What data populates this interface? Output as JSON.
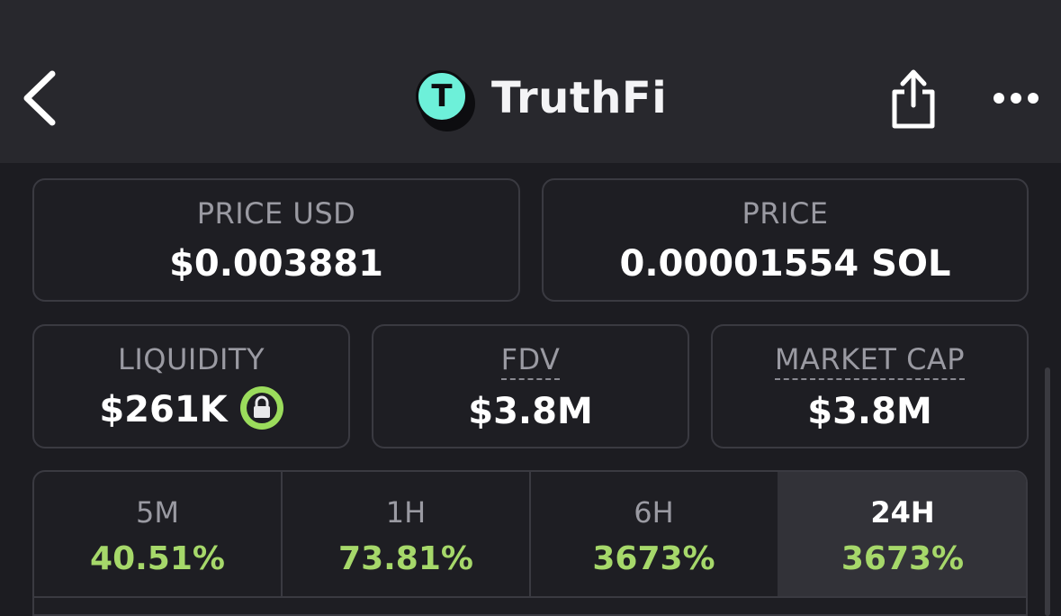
{
  "header": {
    "title": "TruthFi",
    "logo_letter": "T",
    "logo_color": "#6df0d9"
  },
  "icons": {
    "back": "chevron-left-icon",
    "share": "share-icon",
    "more": "more-horizontal-icon",
    "lock": "lock-icon"
  },
  "price_cards": [
    {
      "label": "PRICE USD",
      "value": "$0.003881"
    },
    {
      "label": "PRICE",
      "value": "0.00001554 SOL"
    }
  ],
  "stat_cards": [
    {
      "label": "LIQUIDITY",
      "value": "$261K"
    },
    {
      "label": "FDV",
      "value": "$3.8M"
    },
    {
      "label": "MARKET CAP",
      "value": "$3.8M"
    }
  ],
  "change_tabs": [
    {
      "label": "5M",
      "value": "40.51%"
    },
    {
      "label": "1H",
      "value": "73.81%"
    },
    {
      "label": "6H",
      "value": "3673%"
    },
    {
      "label": "24H",
      "value": "3673%",
      "active": true
    }
  ],
  "colors": {
    "positive": "#a6d86a",
    "lock_ring": "#9bdc5c",
    "background": "#1c1c21",
    "header_background": "#28282d"
  }
}
